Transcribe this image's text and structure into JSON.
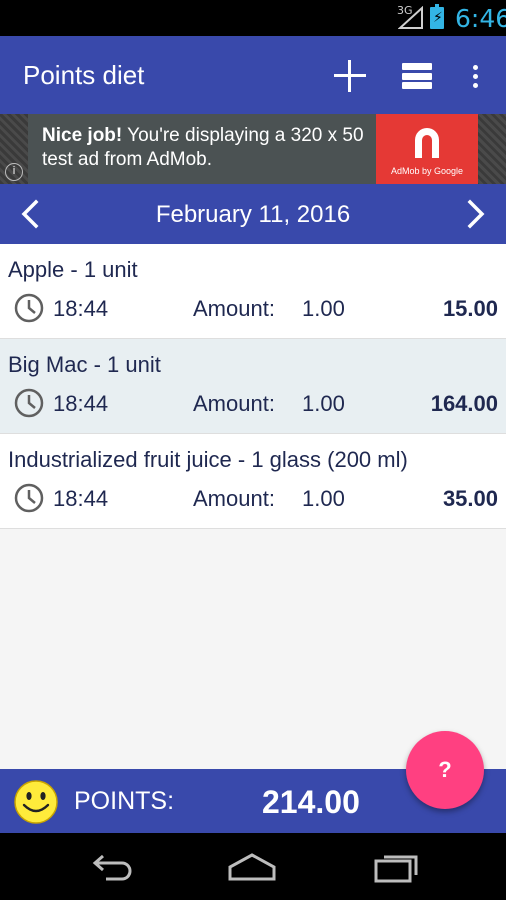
{
  "status_bar": {
    "network_label": "3G",
    "time": "6:46",
    "signal_icon": "cell-signal-icon",
    "battery_icon": "battery-charging-icon"
  },
  "toolbar": {
    "title": "Points diet",
    "add_icon": "plus-icon",
    "list_icon": "list-icon",
    "more_icon": "more-vert-icon"
  },
  "ad": {
    "headline": "Nice job!",
    "body": " You're displaying a 320 x 50 test ad from AdMob.",
    "brand": "AdMob by Google",
    "info_icon": "info-icon"
  },
  "date_bar": {
    "date": "February 11, 2016",
    "prev_icon": "chevron-left-icon",
    "next_icon": "chevron-right-icon"
  },
  "entries": [
    {
      "name": "Apple - 1 unit",
      "time": "18:44",
      "amount_label": "Amount:",
      "amount": "1.00",
      "points": "15.00"
    },
    {
      "name": "Big Mac - 1 unit",
      "time": "18:44",
      "amount_label": "Amount:",
      "amount": "1.00",
      "points": "164.00"
    },
    {
      "name": "Industrialized fruit juice - 1 glass (200 ml)",
      "time": "18:44",
      "amount_label": "Amount:",
      "amount": "1.00",
      "points": "35.00"
    }
  ],
  "footer": {
    "label": "POINTS:",
    "total": "214.00",
    "smiley_icon": "smiley-icon"
  },
  "fab": {
    "label": "?"
  },
  "colors": {
    "primary": "#3949ab",
    "accent": "#ff4081",
    "row_alt": "#e8eff2",
    "ad_red": "#e53935"
  }
}
